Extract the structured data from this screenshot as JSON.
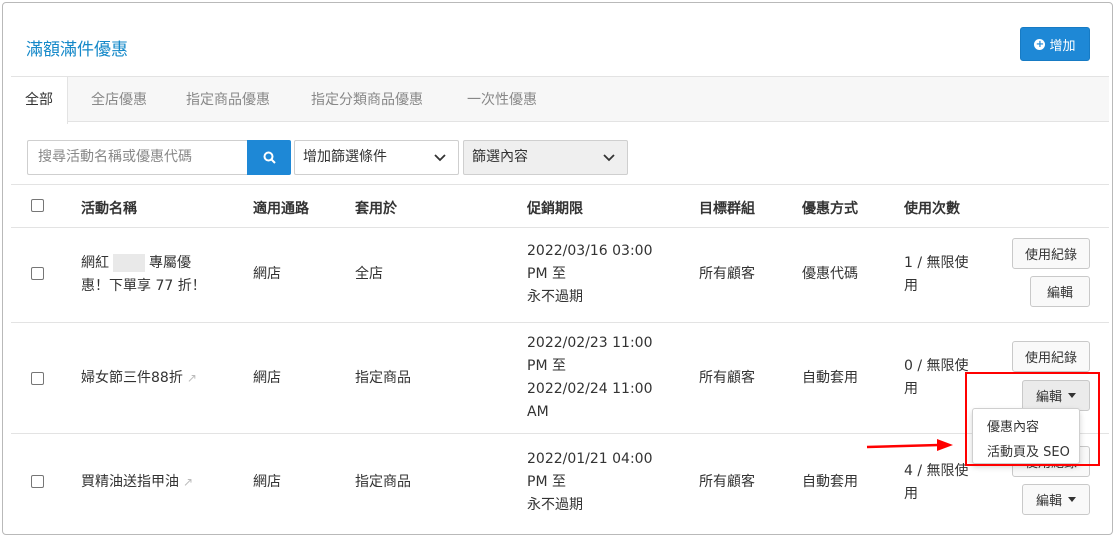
{
  "page": {
    "title": "滿額滿件優惠",
    "add_button": "增加"
  },
  "tabs": [
    "全部",
    "全店優惠",
    "指定商品優惠",
    "指定分類商品優惠",
    "一次性優惠"
  ],
  "filters": {
    "search_placeholder": "搜尋活動名稱或優惠代碼",
    "add_filter": "增加篩選條件",
    "filter_content": "篩選內容"
  },
  "table": {
    "headers": [
      "活動名稱",
      "適用通路",
      "套用於",
      "促銷期限",
      "目標群組",
      "優惠方式",
      "使用次數"
    ],
    "rows": [
      {
        "name_1": "網紅",
        "name_2": "專屬優",
        "name_3": "惠！下單享 77 折！",
        "channel": "網店",
        "apply_to": "全店",
        "period": [
          "2022/03/16 03:00",
          "PM 至",
          "永不過期"
        ],
        "group": "所有顧客",
        "method": "優惠代碼",
        "usage": [
          "1 / 無限使",
          "用"
        ]
      },
      {
        "name": "婦女節三件88折",
        "channel": "網店",
        "apply_to": "指定商品",
        "period": [
          "2022/02/23 11:00",
          "PM 至",
          "2022/02/24 11:00",
          "AM"
        ],
        "group": "所有顧客",
        "method": "自動套用",
        "usage": [
          "0 / 無限使",
          "用"
        ]
      },
      {
        "name": "買精油送指甲油",
        "channel": "網店",
        "apply_to": "指定商品",
        "period": [
          "2022/01/21 04:00",
          "PM 至",
          "永不過期"
        ],
        "group": "所有顧客",
        "method": "自動套用",
        "usage": [
          "4 / 無限使",
          "用"
        ]
      }
    ],
    "row_actions": {
      "usage_log": "使用紀錄",
      "edit": "編輯"
    }
  },
  "dropdown_menu": [
    "優惠內容",
    "活動頁及 SEO"
  ],
  "colors": {
    "accent": "#1e88d6",
    "title": "#1589c9",
    "annotation": "#ff0000"
  }
}
